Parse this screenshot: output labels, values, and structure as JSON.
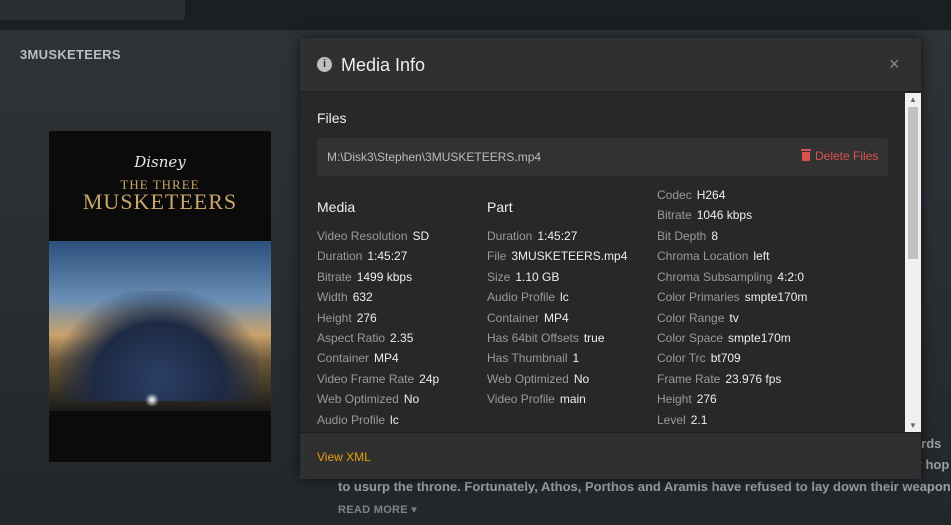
{
  "page": {
    "title": "3MUSKETEERS"
  },
  "poster": {
    "brand": "Disney",
    "title_line1": "THE THREE",
    "title_line2": "MUSKETEERS"
  },
  "summary": {
    "line_right1": "uards",
    "line_right2": "ly hop",
    "line_bottom": "to usurp the throne. Fortunately, Athos, Porthos and Aramis have refused to lay down their weapons",
    "read_more": "READ MORE ▾"
  },
  "modal": {
    "title": "Media Info",
    "close": "×",
    "files_heading": "Files",
    "file_path": "M:\\Disk3\\Stephen\\3MUSKETEERS.mp4",
    "delete_label": "Delete Files",
    "view_xml": "View XML",
    "media": {
      "heading": "Media",
      "rows": [
        {
          "k": "Video Resolution",
          "v": "SD"
        },
        {
          "k": "Duration",
          "v": "1:45:27"
        },
        {
          "k": "Bitrate",
          "v": "1499 kbps"
        },
        {
          "k": "Width",
          "v": "632"
        },
        {
          "k": "Height",
          "v": "276"
        },
        {
          "k": "Aspect Ratio",
          "v": "2.35"
        },
        {
          "k": "Container",
          "v": "MP4"
        },
        {
          "k": "Video Frame Rate",
          "v": "24p"
        },
        {
          "k": "Web Optimized",
          "v": "No"
        },
        {
          "k": "Audio Profile",
          "v": "lc"
        }
      ]
    },
    "part": {
      "heading": "Part",
      "rows": [
        {
          "k": "Duration",
          "v": "1:45:27"
        },
        {
          "k": "File",
          "v": "3MUSKETEERS.mp4"
        },
        {
          "k": "Size",
          "v": "1.10 GB"
        },
        {
          "k": "Audio Profile",
          "v": "lc"
        },
        {
          "k": "Container",
          "v": "MP4"
        },
        {
          "k": "Has 64bit Offsets",
          "v": "true"
        },
        {
          "k": "Has Thumbnail",
          "v": "1"
        },
        {
          "k": "Web Optimized",
          "v": "No"
        },
        {
          "k": "Video Profile",
          "v": "main"
        }
      ]
    },
    "stream": {
      "rows": [
        {
          "k": "Codec",
          "v": "H264"
        },
        {
          "k": "Bitrate",
          "v": "1046 kbps"
        },
        {
          "k": "Bit Depth",
          "v": "8"
        },
        {
          "k": "Chroma Location",
          "v": "left"
        },
        {
          "k": "Chroma Subsampling",
          "v": "4:2:0"
        },
        {
          "k": "Color Primaries",
          "v": "smpte170m"
        },
        {
          "k": "Color Range",
          "v": "tv"
        },
        {
          "k": "Color Space",
          "v": "smpte170m"
        },
        {
          "k": "Color Trc",
          "v": "bt709"
        },
        {
          "k": "Frame Rate",
          "v": "23.976 fps"
        },
        {
          "k": "Height",
          "v": "276"
        },
        {
          "k": "Level",
          "v": "2.1"
        }
      ]
    },
    "scroll": {
      "up": "▲",
      "down": "▼"
    }
  },
  "colors": {
    "accent": "#e5a00d",
    "danger": "#d9534f",
    "modal_bg": "#282828"
  },
  "icons": {
    "info": "info-icon",
    "close": "close-icon",
    "trash": "trash-icon"
  }
}
